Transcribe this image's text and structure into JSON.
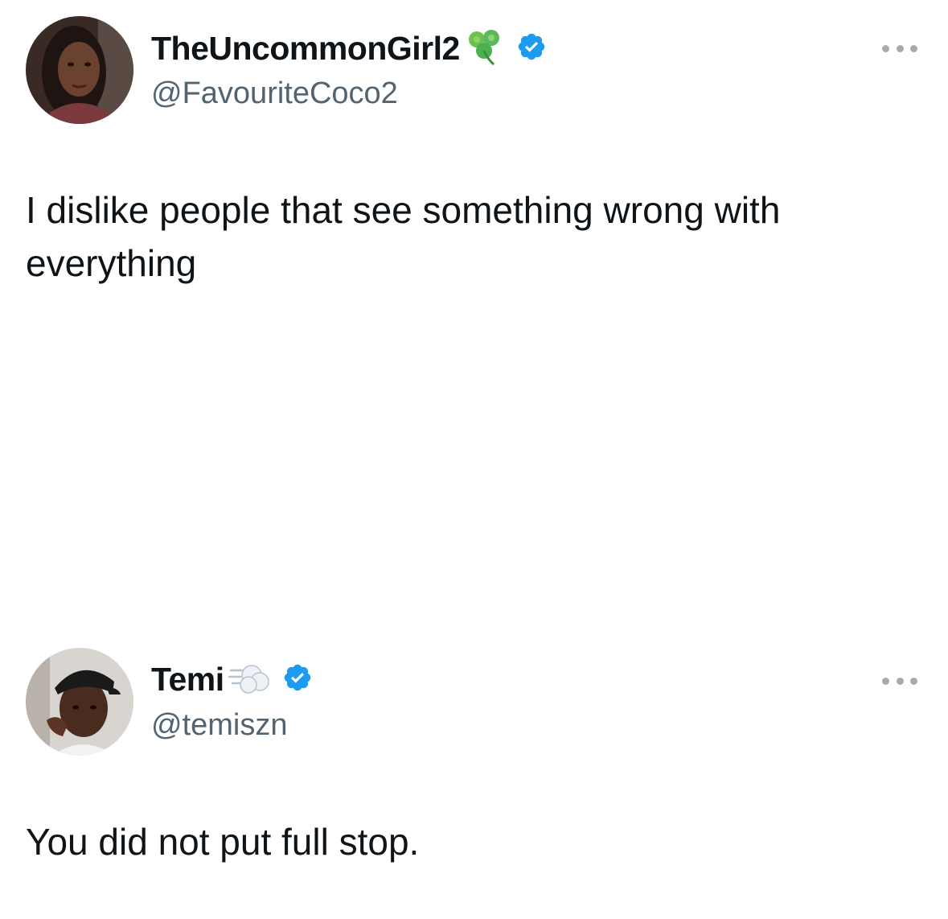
{
  "tweets": [
    {
      "display_name": "TheUncommonGirl2",
      "name_emoji": "shamrock-emoji",
      "verified": true,
      "handle": "@FavouriteCoco2",
      "text": "I dislike people that see something wrong with everything",
      "avatar": "profile-photo-woman"
    },
    {
      "display_name": "Temi",
      "name_emoji": "dashing-away-emoji",
      "verified": true,
      "handle": "@temiszn",
      "text": "You did not put full stop.",
      "avatar": "profile-photo-man-cap"
    }
  ],
  "colors": {
    "text": "#0f1419",
    "secondary": "#536471",
    "verified_blue": "#1d9bf0",
    "shamrock_green": "#5cb85c"
  }
}
